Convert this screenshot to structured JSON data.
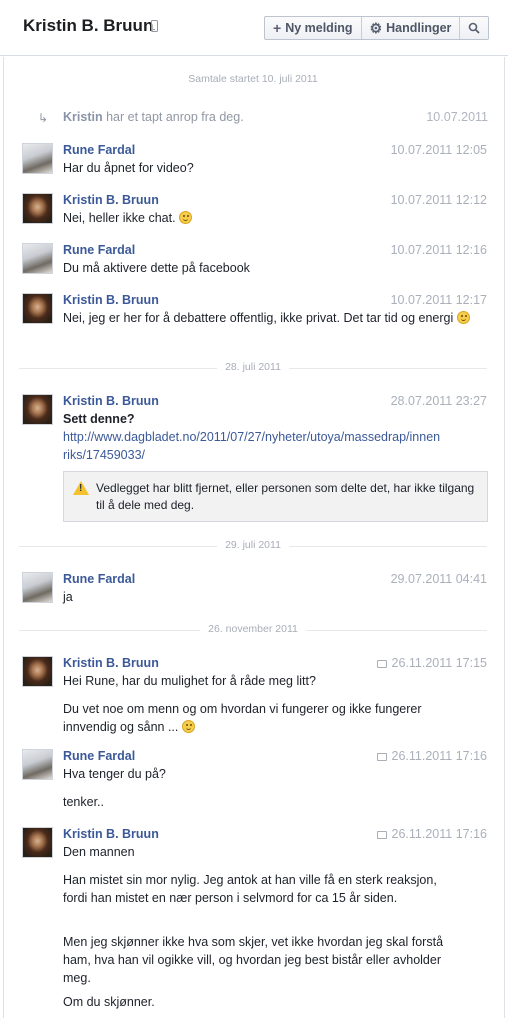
{
  "header": {
    "title": "Kristin B. Bruun",
    "new_message_label": "Ny melding",
    "actions_label": "Handlinger"
  },
  "conversation": {
    "started": "Samtale startet 10. juli 2011",
    "missed_call": {
      "name": "Kristin",
      "text": "har et tapt anrop fra deg.",
      "time": "10.07.2011"
    },
    "messages": [
      {
        "author": "Rune Fardal",
        "time": "10.07.2011 12:05",
        "text": "Har du åpnet for video?"
      },
      {
        "author": "Kristin B. Bruun",
        "time": "10.07.2011 12:12",
        "text": "Nei, heller ikke chat."
      },
      {
        "author": "Rune Fardal",
        "time": "10.07.2011 12:16",
        "text": "Du må aktivere dette på facebook"
      },
      {
        "author": "Kristin B. Bruun",
        "time": "10.07.2011 12:17",
        "text": "Nei, jeg er her for å debattere offentlig, ikke privat. Det tar tid og energi"
      },
      {
        "author": "Kristin B. Bruun",
        "time": "28.07.2011 23:27",
        "text": "Sett denne?",
        "link": "http://www.dagbladet.no/2011/07/27/nyheter/utoya/massedrap/innenriks/17459033/"
      },
      {
        "author": "Rune Fardal",
        "time": "29.07.2011 04:41",
        "text": "ja"
      },
      {
        "author": "Kristin B. Bruun",
        "time": "26.11.2011 17:15",
        "text": "Hei Rune, har du mulighet for å råde meg litt?",
        "text2": "Du vet noe om menn og om hvordan vi fungerer og ikke fungerer innvendig og sånn ..."
      },
      {
        "author": "Rune Fardal",
        "time": "26.11.2011 17:16",
        "text": "Hva tenger du på?",
        "text2": "tenker.."
      },
      {
        "author": "Kristin B. Bruun",
        "time": "26.11.2011 17:16",
        "text": "Den mannen",
        "text2": "Han mistet sin mor nylig. Jeg antok at han ville få en sterk reaksjon, fordi han mistet en nær person i selvmord for ca 15 år siden.",
        "text3": "Men jeg skjønner ikke hva som skjer, vet ikke hvordan jeg skal forstå ham, hva han vil ogikke vill, og hvordan jeg best bistår eller avholder meg.",
        "text4": "Om du skjønner."
      }
    ],
    "attachment_notice": "Vedlegget har blitt fjernet, eller personen som delte det, har ikke tilgang til å dele med deg.",
    "separators": [
      "28. juli 2011",
      "29. juli 2011",
      "26. november 2011"
    ]
  }
}
